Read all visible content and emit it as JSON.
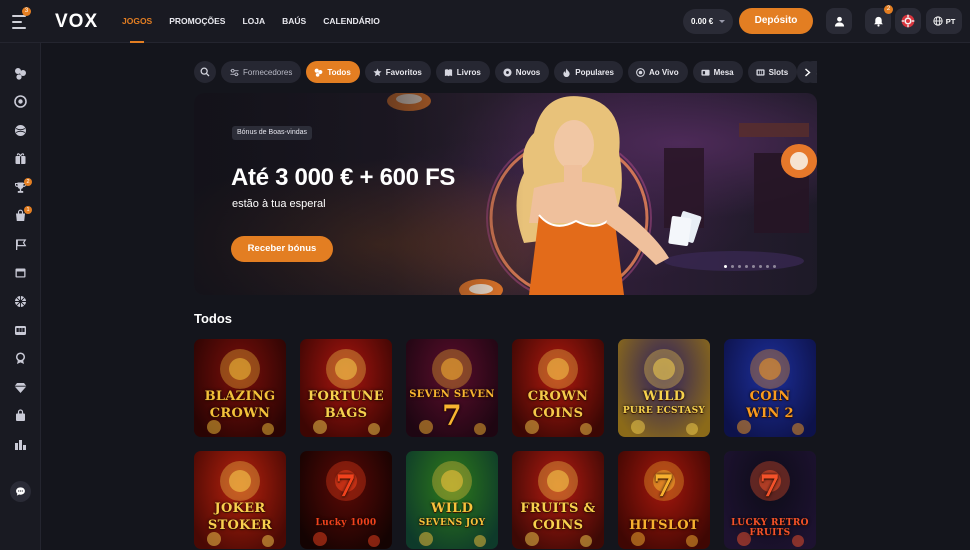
{
  "header": {
    "menu_badge": "3",
    "logo": "VOX",
    "nav": [
      "JOGOS",
      "PROMOÇÕES",
      "LOJA",
      "BAÚS",
      "CALENDÁRIO"
    ],
    "balance": "0.00 €",
    "deposit_label": "Depósito",
    "notifications_badge": "2",
    "language": "PT"
  },
  "sidebar": {
    "icons": [
      "casino-chips-icon",
      "roulette-icon",
      "sports-ball-icon",
      "gift-icon",
      "trophy-icon",
      "shop-icon",
      "flag-icon",
      "calendar-icon",
      "wheel-icon",
      "jackpot-icon",
      "badge-icon",
      "diamond-icon",
      "bag-icon",
      "leaderboard-icon"
    ],
    "trophy_badge": "2",
    "shop_badge": "1"
  },
  "filters": {
    "providers_label": "Fornecedores",
    "chips": [
      "Todos",
      "Favoritos",
      "Livros",
      "Novos",
      "Populares",
      "Ao Vivo",
      "Mesa",
      "Slots",
      "C"
    ],
    "active": "Todos"
  },
  "banner": {
    "tag": "Bónus de Boas-vindas",
    "title": "Até 3 000 € + 600 FS",
    "subtitle": "estão à tua esperal",
    "cta": "Receber bónus",
    "slides": 8,
    "active_slide": 0
  },
  "section": {
    "title": "Todos",
    "games": [
      {
        "line1": "BLAZING",
        "line2": "CROWN",
        "bg1": "#7a0f0a",
        "bg2": "#2a0403",
        "color": "#f3c13a"
      },
      {
        "line1": "FORTUNE",
        "line2": "BAGS",
        "bg1": "#a8150f",
        "bg2": "#3d0603",
        "color": "#f6d04d"
      },
      {
        "line1": "SEVEN SEVEN",
        "line2": "7",
        "bg1": "#5a0d2b",
        "bg2": "#1e0612",
        "color": "#f7b531"
      },
      {
        "line1": "CROWN",
        "line2": "COINS",
        "bg1": "#b0190e",
        "bg2": "#3b0704",
        "color": "#f6c94a"
      },
      {
        "line1": "WILD",
        "line2": "PURE ECSTASY",
        "bg1": "#2d1f5f",
        "bg2": "#8b6a19",
        "color": "#f5d24d"
      },
      {
        "line1": "COIN",
        "line2": "WIN 2",
        "bg1": "#1d2f9a",
        "bg2": "#0d124a",
        "color": "#f89b1f"
      },
      {
        "line1": "JOKER",
        "line2": "STOKER",
        "bg1": "#b5210d",
        "bg2": "#4a0904",
        "color": "#f9d04e"
      },
      {
        "line1": "7",
        "line2": "Lucky 1000",
        "bg1": "#5a0905",
        "bg2": "#140302",
        "color": "#f2421d"
      },
      {
        "line1": "WILD",
        "line2": "SEVENS JOY",
        "bg1": "#2d7a1a",
        "bg2": "#0e3a2a",
        "color": "#f7c23c"
      },
      {
        "line1": "FRUITS &",
        "line2": "COINS",
        "bg1": "#b31a10",
        "bg2": "#3d0905",
        "color": "#f8d14d"
      },
      {
        "line1": "7",
        "line2": "HITSLOT",
        "bg1": "#a4170c",
        "bg2": "#3f0703",
        "color": "#f7b12f"
      },
      {
        "line1": "7",
        "line2": "LUCKY RETRO FRUITS",
        "bg1": "#0d0c18",
        "bg2": "#1d1230",
        "color": "#f4522a"
      }
    ]
  }
}
